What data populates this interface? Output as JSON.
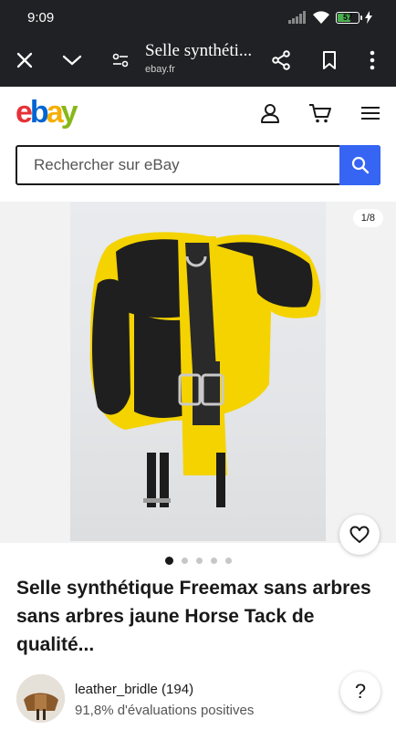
{
  "status_bar": {
    "time": "9:09",
    "battery_level": "57",
    "icons": [
      "signal-icon",
      "wifi-icon",
      "battery-icon",
      "charging-icon"
    ]
  },
  "browser": {
    "page_title": "Selle synthéti...",
    "domain": "ebay.fr",
    "buttons": [
      "close-icon",
      "chevron-down-icon",
      "site-settings-icon",
      "share-icon",
      "bookmark-icon",
      "more-vert-icon"
    ]
  },
  "header": {
    "logo_letters": [
      {
        "ch": "e",
        "color": "#e53238"
      },
      {
        "ch": "b",
        "color": "#0064d2"
      },
      {
        "ch": "a",
        "color": "#f5af02"
      },
      {
        "ch": "y",
        "color": "#86b817"
      }
    ],
    "icons": [
      "account-icon",
      "cart-icon",
      "menu-icon"
    ]
  },
  "search": {
    "placeholder": "Rechercher sur eBay"
  },
  "gallery": {
    "counter": "1/8",
    "current": 1,
    "dots": 5
  },
  "listing": {
    "title": "Selle synthétique Freemax sans arbres sans arbres jaune Horse Tack de qualité..."
  },
  "seller": {
    "name": "leather_bridle (194)",
    "feedback": "91,8% d'évaluations positives"
  },
  "colors": {
    "accent": "#3665f3",
    "topbar": "#202124",
    "saddle_yellow": "#f4d300"
  }
}
